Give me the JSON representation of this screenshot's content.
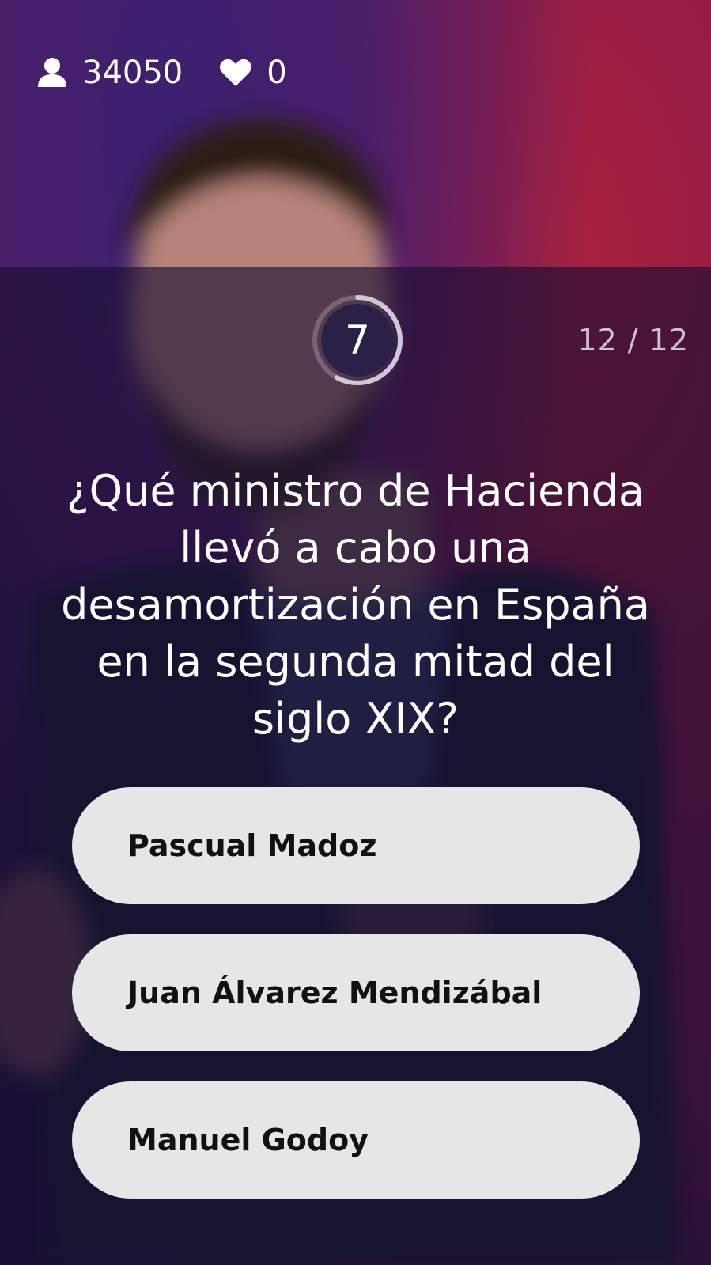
{
  "stats": {
    "viewers_icon": "person-icon",
    "viewers": "34050",
    "likes_icon": "heart-icon",
    "likes": "0"
  },
  "timer": {
    "seconds": "7",
    "remaining_fraction": 0.58
  },
  "progress": {
    "label": "12 / 12"
  },
  "question": {
    "text": "¿Qué ministro de Hacienda llevó a cabo una desamortización en España en la segunda mitad del siglo XIX?"
  },
  "answers": [
    {
      "label": "Pascual Madoz"
    },
    {
      "label": "Juan Álvarez Mendizábal"
    },
    {
      "label": "Manuel Godoy"
    }
  ],
  "colors": {
    "answer_bg": "#e6e6e6",
    "overlay": "#160e30",
    "accent_top_left": "#3a2170",
    "accent_top_right": "#a8203e"
  }
}
